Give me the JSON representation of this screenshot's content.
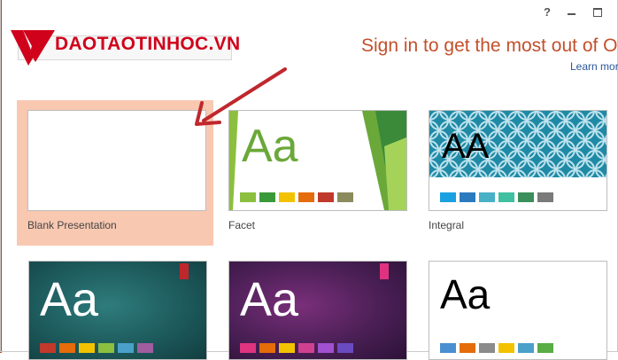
{
  "window": {
    "help": "?",
    "minimize": "minimize",
    "maximize": "maximize"
  },
  "watermark": {
    "text": "DAOTAOTINHOC.VN"
  },
  "header": {
    "signin_text": "Sign in to get the most out of Offic",
    "learn_more": "Learn mor"
  },
  "templates": [
    {
      "label": "Blank Presentation",
      "aa": "",
      "selected": true
    },
    {
      "label": "Facet",
      "aa": "Aa",
      "colors": [
        "#8cbf3f",
        "#3a9a3a",
        "#f2c200",
        "#e46c0a",
        "#c0392b",
        "#8b8b5e"
      ]
    },
    {
      "label": "Integral",
      "aa": "AA",
      "colors": [
        "#1ba1e2",
        "#2b7ac0",
        "#49b1c6",
        "#40c0a0",
        "#3a8f5a",
        "#7a7a7a"
      ]
    },
    {
      "label": "",
      "aa": "Aa",
      "colors": [
        "#c0392b",
        "#e46c0a",
        "#f2c200",
        "#8cbf3f",
        "#4aa0c8",
        "#a05da0"
      ]
    },
    {
      "label": "",
      "aa": "Aa",
      "colors": [
        "#e0337f",
        "#e46c0a",
        "#f2c200",
        "#d04090",
        "#a050d0",
        "#6a4ac0"
      ]
    },
    {
      "label": "",
      "aa": "Aa",
      "colors": [
        "#4a90d0",
        "#e46c0a",
        "#8b8b8b",
        "#f2c200",
        "#4aa0c8",
        "#5aac44"
      ]
    }
  ],
  "colors": {
    "accent": "#c3502b",
    "selected": "#f8c8b1",
    "arrow": "#c0272d"
  }
}
